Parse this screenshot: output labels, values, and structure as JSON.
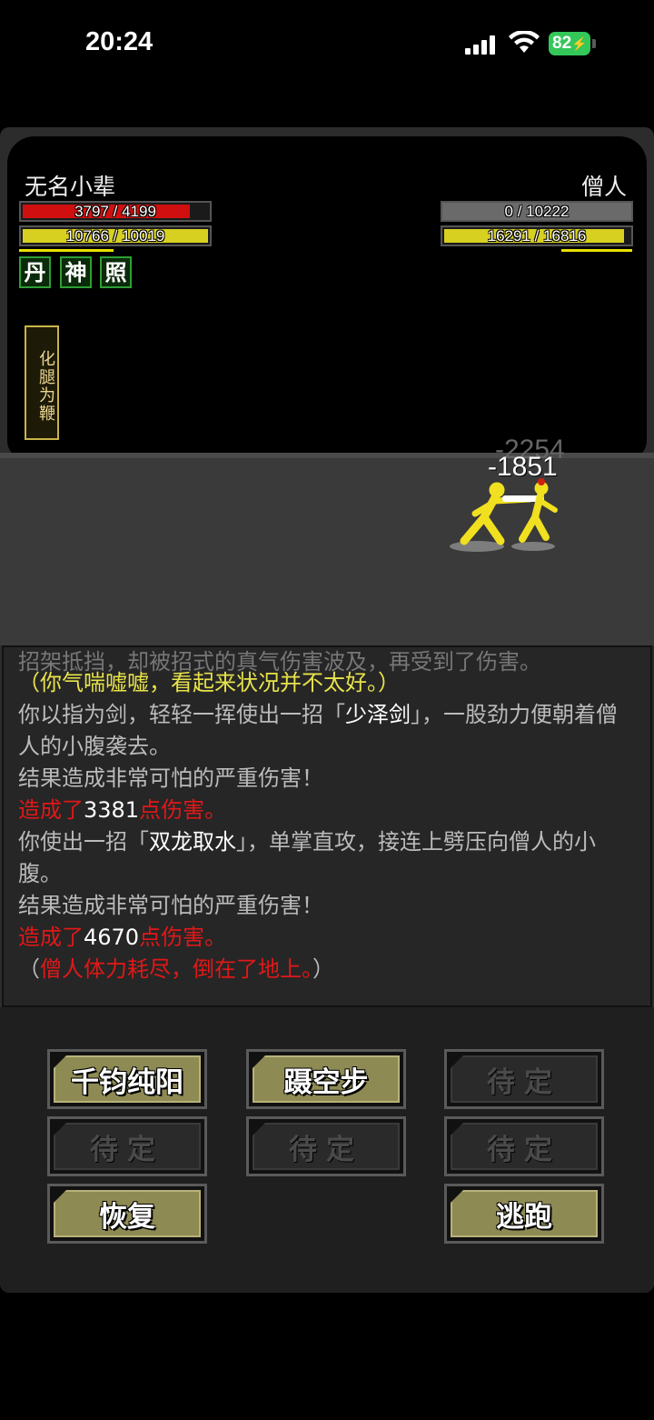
{
  "status_bar": {
    "time": "20:24",
    "battery": "82",
    "battery_color": "#34c759"
  },
  "player": {
    "name": "无名小辈",
    "hp_text": "3797 / 4199",
    "hp_ratio": 0.9,
    "mp_text": "10766 / 10019",
    "mp_ratio": 1.0,
    "buffs": [
      "丹",
      "神",
      "照"
    ],
    "active_skill": "化腿为鞭"
  },
  "enemy": {
    "name": "僧人",
    "hp_text": "0 / 10222",
    "hp_ratio": 0.0,
    "mp_text": "16291 / 16816",
    "mp_ratio": 0.97
  },
  "damage_popups": [
    "-2254",
    "-1851"
  ],
  "log": {
    "cut_top": "招架抵挡，却被招式的真气伤害波及，再受到了伤害。",
    "lines": [
      {
        "parts": [
          {
            "text": "（你气喘嘘嘘，看起来状况并不太好。）",
            "color": "yellow"
          }
        ]
      },
      {
        "parts": [
          {
            "text": "你以指为剑，轻轻一挥使出一招「",
            "color": "gray"
          },
          {
            "text": "少泽剑",
            "color": "white"
          },
          {
            "text": "」，一股劲力便朝着僧人的小腹袭去。",
            "color": "gray"
          }
        ]
      },
      {
        "parts": [
          {
            "text": "结果造成非常可怕的严重伤害！",
            "color": "gray"
          }
        ]
      },
      {
        "parts": [
          {
            "text": "造成了",
            "color": "red"
          },
          {
            "text": "3381",
            "color": "white"
          },
          {
            "text": "点伤害。",
            "color": "red"
          }
        ]
      },
      {
        "parts": [
          {
            "text": "你使出一招「",
            "color": "gray"
          },
          {
            "text": "双龙取水",
            "color": "white"
          },
          {
            "text": "」，单掌直攻，接连上劈压向僧人的小腹。",
            "color": "gray"
          }
        ]
      },
      {
        "parts": [
          {
            "text": "结果造成非常可怕的严重伤害！",
            "color": "gray"
          }
        ]
      },
      {
        "parts": [
          {
            "text": "造成了",
            "color": "red"
          },
          {
            "text": "4670",
            "color": "white"
          },
          {
            "text": "点伤害。",
            "color": "red"
          }
        ]
      },
      {
        "parts": [
          {
            "text": "（",
            "color": "gray"
          },
          {
            "text": "僧人体力耗尽，倒在了地上。",
            "color": "red"
          },
          {
            "text": "）",
            "color": "gray"
          }
        ]
      }
    ]
  },
  "actions": {
    "skill_1": "千钧纯阳",
    "skill_2": "蹑空步",
    "skill_3": "待定",
    "skill_4": "待定",
    "skill_5": "待定",
    "skill_6": "待定",
    "recover": "恢复",
    "escape": "逃跑"
  },
  "colors": {
    "hp": "#d01010",
    "mp": "#d8d020",
    "enemy_hp_empty": "#6a6a6a",
    "fighter": "#f0e020"
  }
}
